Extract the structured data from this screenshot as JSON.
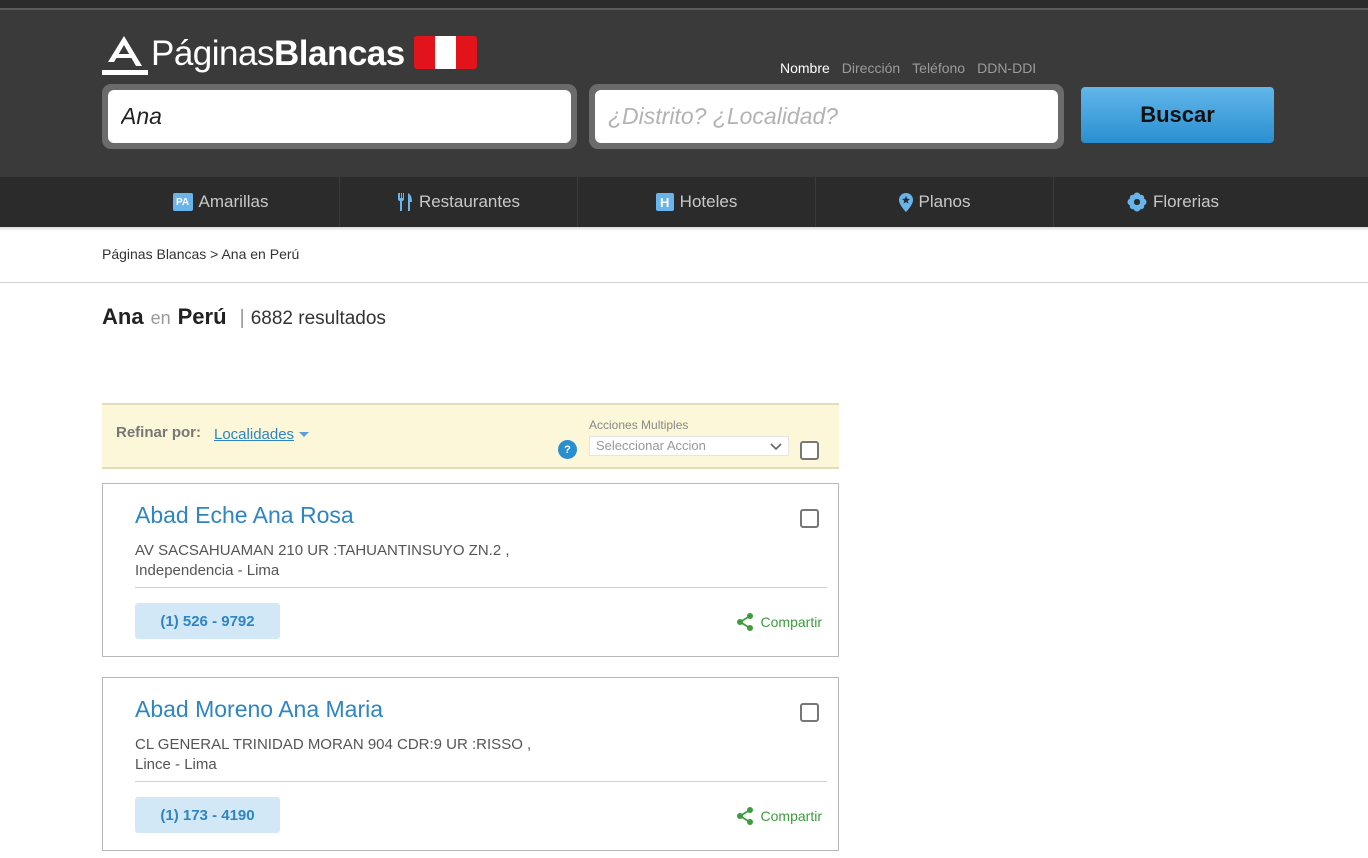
{
  "header": {
    "logo_light": "Páginas",
    "logo_bold": "Blancas",
    "modes": [
      "Nombre",
      "Dirección",
      "Teléfono",
      "DDN-DDI"
    ],
    "search_value": "Ana",
    "location_placeholder": "¿Distrito? ¿Localidad?",
    "search_button": "Buscar"
  },
  "nav": {
    "items": [
      {
        "label": "Amarillas",
        "icon": "pa-icon"
      },
      {
        "label": "Restaurantes",
        "icon": "fork-knife-icon"
      },
      {
        "label": "Hoteles",
        "icon": "hotel-icon"
      },
      {
        "label": "Planos",
        "icon": "map-pin-icon"
      },
      {
        "label": "Florerias",
        "icon": "flower-icon"
      }
    ],
    "pa_text": "PA",
    "h_text": "H"
  },
  "breadcrumb": "Páginas Blancas > Ana en Perú",
  "results": {
    "query": "Ana",
    "en": "en",
    "place": "Perú",
    "sep": "|",
    "count": "6882 resultados"
  },
  "refine": {
    "label": "Refinar por:",
    "link": "Localidades",
    "acciones_label": "Acciones Multiples",
    "help": "?",
    "select_value": "Seleccionar Accion"
  },
  "cards": [
    {
      "name": "Abad Eche Ana Rosa",
      "address": "AV SACSAHUAMAN 210 UR :TAHUANTINSUYO ZN.2 , Independencia - Lima",
      "phone": "(1) 526 - 9792",
      "share": "Compartir"
    },
    {
      "name": "Abad Moreno Ana Maria",
      "address": "CL GENERAL TRINIDAD MORAN 904 CDR:9 UR :RISSO , Lince - Lima",
      "phone": "(1) 173 - 4190",
      "share": "Compartir"
    }
  ],
  "colors": {
    "header_bg": "#3a3a3a",
    "nav_bg": "#2b2b2b",
    "accent_blue": "#2d85c5",
    "refine_bg": "#fcf7d9",
    "share_green": "#3e9b3e",
    "flag_red": "#e3131b"
  }
}
